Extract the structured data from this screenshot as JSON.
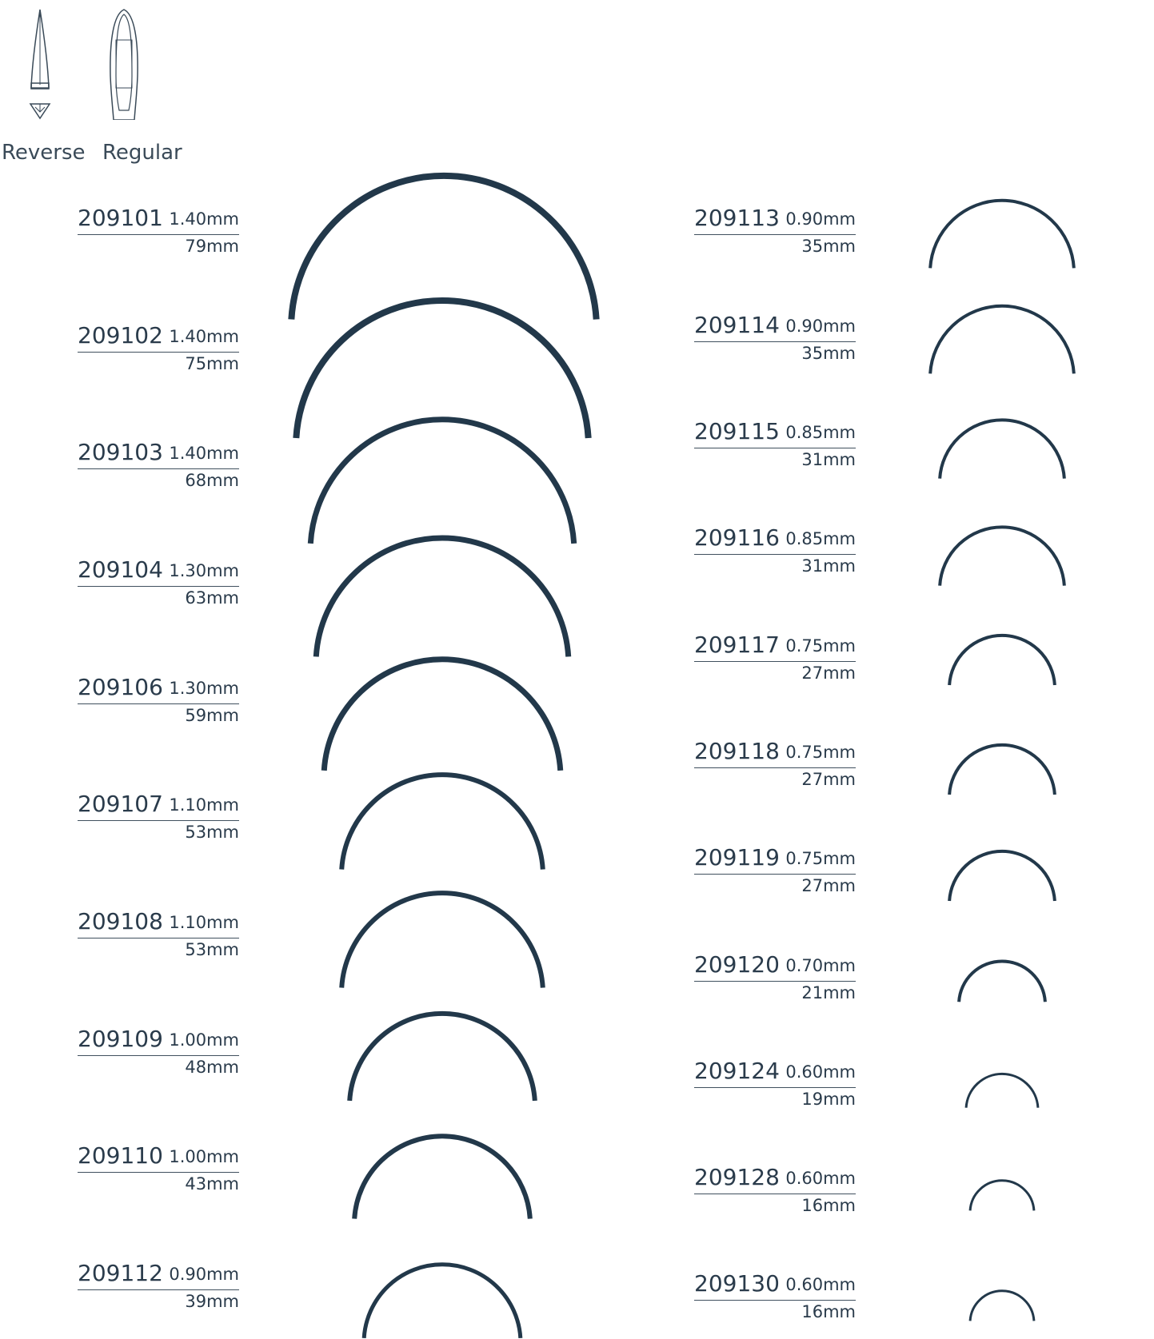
{
  "legend": {
    "reverse_label": "Reverse",
    "regular_label": "Regular",
    "reverse_icon": "reverse-cutting-point-icon",
    "regular_icon": "regular-taper-point-icon"
  },
  "colors": {
    "needle": "#22384a",
    "text": "#2a3b4b",
    "rule": "#40505e"
  },
  "left_column": [
    {
      "code": "209101",
      "diameter": "1.40mm",
      "length": "79mm"
    },
    {
      "code": "209102",
      "diameter": "1.40mm",
      "length": "75mm"
    },
    {
      "code": "209103",
      "diameter": "1.40mm",
      "length": "68mm"
    },
    {
      "code": "209104",
      "diameter": "1.30mm",
      "length": "63mm"
    },
    {
      "code": "209106",
      "diameter": "1.30mm",
      "length": "59mm"
    },
    {
      "code": "209107",
      "diameter": "1.10mm",
      "length": "53mm"
    },
    {
      "code": "209108",
      "diameter": "1.10mm",
      "length": "53mm"
    },
    {
      "code": "209109",
      "diameter": "1.00mm",
      "length": "48mm"
    },
    {
      "code": "209110",
      "diameter": "1.00mm",
      "length": "43mm"
    },
    {
      "code": "209112",
      "diameter": "0.90mm",
      "length": "39mm"
    }
  ],
  "right_column": [
    {
      "code": "209113",
      "diameter": "0.90mm",
      "length": "35mm"
    },
    {
      "code": "209114",
      "diameter": "0.90mm",
      "length": "35mm"
    },
    {
      "code": "209115",
      "diameter": "0.85mm",
      "length": "31mm"
    },
    {
      "code": "209116",
      "diameter": "0.85mm",
      "length": "31mm"
    },
    {
      "code": "209117",
      "diameter": "0.75mm",
      "length": "27mm"
    },
    {
      "code": "209118",
      "diameter": "0.75mm",
      "length": "27mm"
    },
    {
      "code": "209119",
      "diameter": "0.75mm",
      "length": "27mm"
    },
    {
      "code": "209120",
      "diameter": "0.70mm",
      "length": "21mm"
    },
    {
      "code": "209124",
      "diameter": "0.60mm",
      "length": "19mm"
    },
    {
      "code": "209128",
      "diameter": "0.60mm",
      "length": "16mm"
    },
    {
      "code": "209130",
      "diameter": "0.60mm",
      "length": "16mm"
    }
  ]
}
